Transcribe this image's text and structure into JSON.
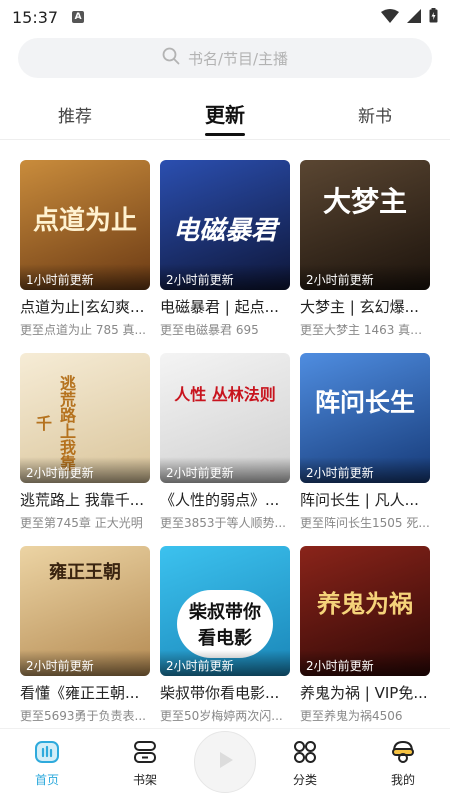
{
  "status_bar": {
    "time": "15:37",
    "notif_letter": "A"
  },
  "search": {
    "placeholder": "书名/节目/主播"
  },
  "tabs": [
    {
      "label": "推荐",
      "active": false
    },
    {
      "label": "更新",
      "active": true
    },
    {
      "label": "新书",
      "active": false
    }
  ],
  "books": [
    {
      "cover_text": "点道为止",
      "badge": "1小时前更新",
      "title": "点道为止|玄幻爽...",
      "sub": "更至点道为止 785 真...",
      "bg": "#8a5a2a"
    },
    {
      "cover_text": "电磁暴君",
      "badge": "2小时前更新",
      "title": "电磁暴君 | 起点...",
      "sub": "更至电磁暴君 695",
      "bg": "#1c2d6b"
    },
    {
      "cover_text": "大梦主",
      "badge": "2小时前更新",
      "title": "大梦主 | 玄幻爆...",
      "sub": "更至大梦主 1463 真的...",
      "bg": "#3a2a1e"
    },
    {
      "cover_text": "逃荒路上我靠千",
      "badge": "2小时前更新",
      "title": "逃荒路上 我靠千...",
      "sub": "更至第745章 正大光明",
      "bg": "#efe3c9"
    },
    {
      "cover_text": "人性 丛林法则",
      "badge": "2小时前更新",
      "title": "《人性的弱点》...",
      "sub": "更至3853于等人顺势...",
      "bg": "#e9e9e9"
    },
    {
      "cover_text": "阵问长生",
      "badge": "2小时前更新",
      "title": "阵问长生 | 凡人...",
      "sub": "更至阵问长生1505 死...",
      "bg": "#245a9c"
    },
    {
      "cover_text": "雍正王朝",
      "badge": "2小时前更新",
      "title": "看懂《雍正王朝...",
      "sub": "更至5693勇于负责表...",
      "bg": "#d9b784"
    },
    {
      "cover_text": "柴叔带你看电影",
      "badge": "2小时前更新",
      "title": "柴叔带你看电影...",
      "sub": "更至50岁梅婷两次闪...",
      "bg": "#2fb3e0"
    },
    {
      "cover_text": "养鬼为祸",
      "badge": "2小时前更新",
      "title": "养鬼为祸 | VIP免...",
      "sub": "更至养鬼为祸4506",
      "bg": "#5a1410"
    }
  ],
  "bottom_nav": {
    "home": "首页",
    "shelf": "书架",
    "category": "分类",
    "mine": "我的"
  },
  "colors": {
    "accent": "#2eaadc"
  }
}
